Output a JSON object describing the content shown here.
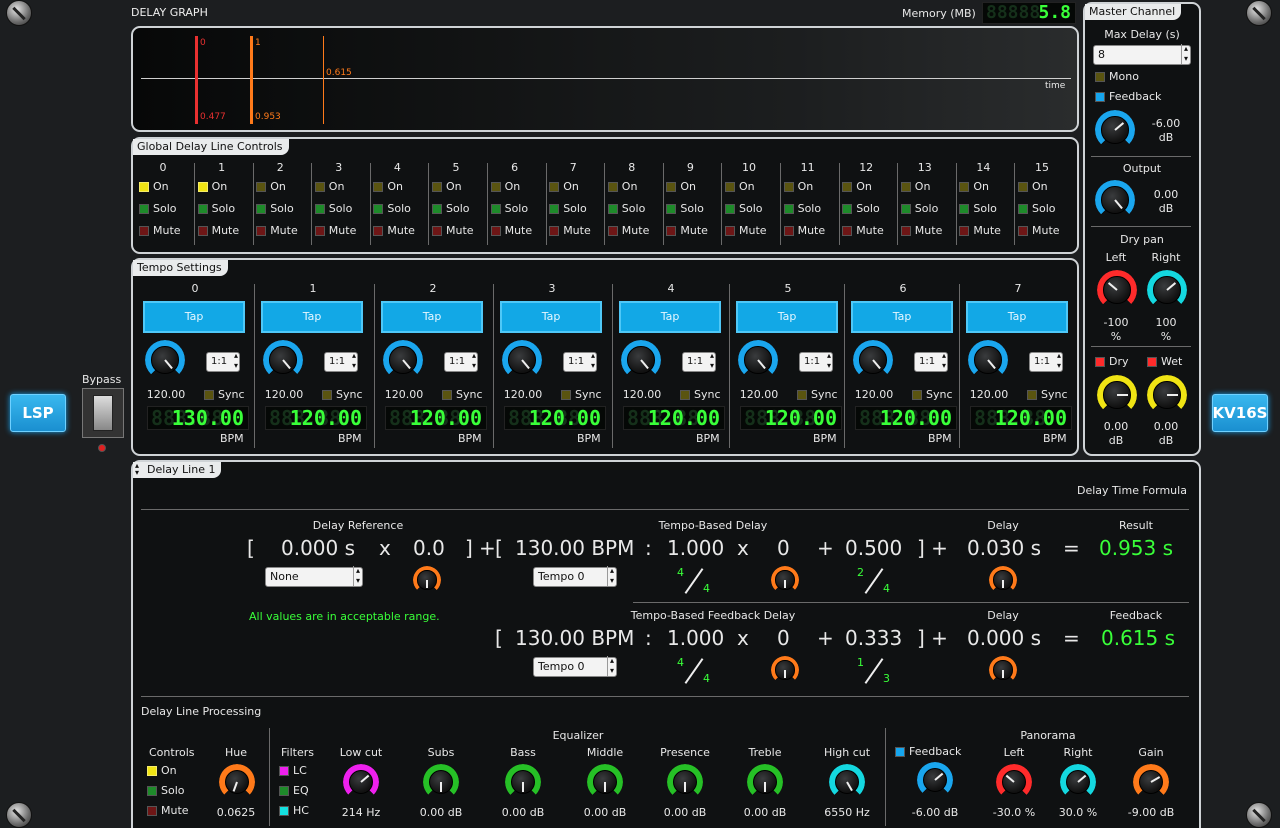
{
  "side": {
    "left_logo": "LSP",
    "right_logo": "KV16S",
    "bypass_label": "Bypass"
  },
  "graph": {
    "title": "DELAY GRAPH",
    "memory_label": "Memory (MB)",
    "memory_value": "5.8",
    "time_label": "time",
    "markers": [
      {
        "top": "0",
        "bottom": "0.477"
      },
      {
        "top": "1",
        "bottom": "0.953"
      },
      {
        "top": "",
        "side": "0.615"
      }
    ]
  },
  "global": {
    "title": "Global Delay Line Controls",
    "on": "On",
    "solo": "Solo",
    "mute": "Mute",
    "channels": [
      "0",
      "1",
      "2",
      "3",
      "4",
      "5",
      "6",
      "7",
      "8",
      "9",
      "10",
      "11",
      "12",
      "13",
      "14",
      "15"
    ]
  },
  "tempo": {
    "title": "Tempo Settings",
    "tap": "Tap",
    "sync": "Sync",
    "bpm_unit": "BPM",
    "ratio": "1:1",
    "items": [
      {
        "num": "0",
        "knob": "120.00",
        "display": "130.00"
      },
      {
        "num": "1",
        "knob": "120.00",
        "display": "120.00"
      },
      {
        "num": "2",
        "knob": "120.00",
        "display": "120.00"
      },
      {
        "num": "3",
        "knob": "120.00",
        "display": "120.00"
      },
      {
        "num": "4",
        "knob": "120.00",
        "display": "120.00"
      },
      {
        "num": "5",
        "knob": "120.00",
        "display": "120.00"
      },
      {
        "num": "6",
        "knob": "120.00",
        "display": "120.00"
      },
      {
        "num": "7",
        "knob": "120.00",
        "display": "120.00"
      }
    ]
  },
  "master": {
    "title": "Master Channel",
    "max_delay_label": "Max Delay (s)",
    "max_delay_value": "8",
    "mono": "Mono",
    "feedback": "Feedback",
    "feedback_value": "-6.00",
    "feedback_unit": "dB",
    "output_label": "Output",
    "output_value": "0.00",
    "output_unit": "dB",
    "drypan_label": "Dry pan",
    "left": "Left",
    "right": "Right",
    "left_value": "-100",
    "right_value": "100",
    "pct": "%",
    "dry": "Dry",
    "wet": "Wet",
    "dry_value": "0.00",
    "wet_value": "0.00",
    "db": "dB"
  },
  "line": {
    "selector": "Delay Line 1",
    "formula_title": "Delay Time Formula",
    "delay_ref_label": "Delay Reference",
    "tempo_delay_label": "Tempo-Based Delay",
    "delay_label": "Delay",
    "result_label": "Result",
    "ref_value": "0.000 s",
    "ref_mult": "0.0",
    "ref_combo": "None",
    "bpm": "130.00 BPM",
    "mul": "1.000",
    "mult2": "0",
    "frac": "0.500",
    "delay": "0.030 s",
    "result": "0.953 s",
    "tempo_combo": "Tempo 0",
    "frac1_num": "4",
    "frac1_den": "4",
    "frac2_num": "2",
    "frac2_den": "4",
    "status": "All values are in acceptable range.",
    "fb_label": "Tempo-Based Feedback Delay",
    "fb_delay_label": "Delay",
    "fb_result_label": "Feedback",
    "fb_bpm": "130.00 BPM",
    "fb_mul": "1.000",
    "fb_mult2": "0",
    "fb_frac": "0.333",
    "fb_delay": "0.000 s",
    "fb_result": "0.615 s",
    "fb_combo": "Tempo 0",
    "frac3_num": "4",
    "frac3_den": "4",
    "frac4_num": "1",
    "frac4_den": "3",
    "sym_lb": "[",
    "sym_rb": "]",
    "sym_x": "x",
    "sym_plus": "+",
    "sym_rbplus": "] +",
    "sym_colon": ":",
    "sym_eq": "="
  },
  "proc": {
    "title": "Delay Line Processing",
    "controls": "Controls",
    "on": "On",
    "solo": "Solo",
    "mute": "Mute",
    "hue": "Hue",
    "hue_value": "0.0625",
    "filters": "Filters",
    "lc": "LC",
    "eq": "EQ",
    "hc": "HC",
    "equalizer": "Equalizer",
    "panorama": "Panorama",
    "bands": [
      {
        "label": "Low cut",
        "value": "214 Hz"
      },
      {
        "label": "Subs",
        "value": "0.00 dB"
      },
      {
        "label": "Bass",
        "value": "0.00 dB"
      },
      {
        "label": "Middle",
        "value": "0.00 dB"
      },
      {
        "label": "Presence",
        "value": "0.00 dB"
      },
      {
        "label": "Treble",
        "value": "0.00 dB"
      },
      {
        "label": "High cut",
        "value": "6550 Hz"
      }
    ],
    "feedback": "Feedback",
    "feedback_value": "-6.00 dB",
    "left": "Left",
    "left_value": "-30.0 %",
    "right": "Right",
    "right_value": "30.0 %",
    "gain": "Gain",
    "gain_value": "-9.00 dB"
  },
  "colors": {
    "accent": "#12a8e6",
    "green": "#39ff39",
    "red": "#ff2b2b",
    "orange": "#ff7a1a",
    "yellow": "#f0e414"
  }
}
